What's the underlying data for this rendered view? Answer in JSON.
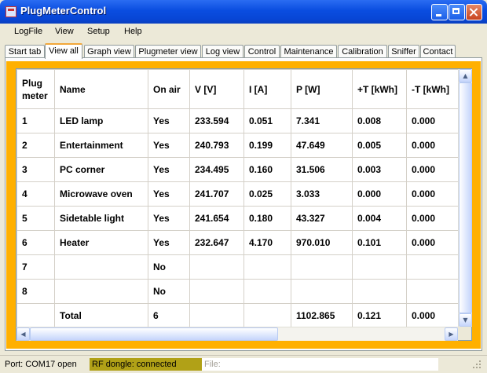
{
  "window": {
    "title": "PlugMeterControl"
  },
  "menu": [
    "LogFile",
    "View",
    "Setup",
    "Help"
  ],
  "tabs": [
    {
      "label": "Start tab"
    },
    {
      "label": "View all",
      "active": true
    },
    {
      "label": "Graph view"
    },
    {
      "label": "Plugmeter view"
    },
    {
      "label": "Log view"
    },
    {
      "label": "Control"
    },
    {
      "label": "Maintenance"
    },
    {
      "label": "Calibration"
    },
    {
      "label": "Sniffer"
    },
    {
      "label": "Contact"
    }
  ],
  "table": {
    "headers": [
      "Plug\nmeter",
      "Name",
      "On air",
      "V [V]",
      "I [A]",
      "P [W]",
      "+T [kWh]",
      "-T [kWh]"
    ],
    "rows": [
      [
        "1",
        "LED lamp",
        "Yes",
        "233.594",
        "0.051",
        "7.341",
        "0.008",
        "0.000"
      ],
      [
        "2",
        "Entertainment",
        "Yes",
        "240.793",
        "0.199",
        "47.649",
        "0.005",
        "0.000"
      ],
      [
        "3",
        "PC corner",
        "Yes",
        "234.495",
        "0.160",
        "31.506",
        "0.003",
        "0.000"
      ],
      [
        "4",
        "Microwave oven",
        "Yes",
        "241.707",
        "0.025",
        "3.033",
        "0.000",
        "0.000"
      ],
      [
        "5",
        "Sidetable light",
        "Yes",
        "241.654",
        "0.180",
        "43.327",
        "0.004",
        "0.000"
      ],
      [
        "6",
        "Heater",
        "Yes",
        "232.647",
        "4.170",
        "970.010",
        "0.101",
        "0.000"
      ],
      [
        "7",
        "",
        "No",
        "",
        "",
        "",
        "",
        ""
      ],
      [
        "8",
        "",
        "No",
        "",
        "",
        "",
        "",
        ""
      ],
      [
        "",
        "Total",
        "6",
        "",
        "",
        "1102.865",
        "0.121",
        "0.000"
      ]
    ]
  },
  "status": {
    "port": "Port: COM17 open",
    "rf": "RF dongle:  connected",
    "file": "File:"
  },
  "colors": {
    "accent": "#ffb000",
    "rf_bg": "#b1a117",
    "titlebar": "#0a4de0"
  }
}
